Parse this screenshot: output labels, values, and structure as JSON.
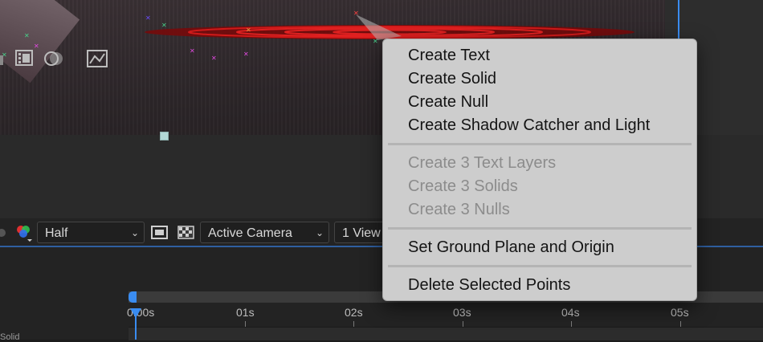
{
  "viewer": {
    "resolution": {
      "value": "Half"
    },
    "camera": {
      "value": "Active Camera"
    },
    "views": {
      "value": "1 View"
    }
  },
  "timeline": {
    "time_labels": [
      "0:00s",
      "01s",
      "02s",
      "03s",
      "04s",
      "05s"
    ],
    "layer_label": "Solid"
  },
  "context_menu": {
    "items": [
      {
        "label": "Create Text",
        "enabled": true
      },
      {
        "label": "Create Solid",
        "enabled": true
      },
      {
        "label": "Create Null",
        "enabled": true
      },
      {
        "label": "Create Shadow Catcher and Light",
        "enabled": true
      },
      {
        "label": "Create 3 Text Layers",
        "enabled": false
      },
      {
        "label": "Create 3 Solids",
        "enabled": false
      },
      {
        "label": "Create 3 Nulls",
        "enabled": false
      },
      {
        "label": "Set Ground Plane and Origin",
        "enabled": true
      },
      {
        "label": "Delete Selected Points",
        "enabled": true
      }
    ]
  },
  "colors": {
    "accent": "#3a8cf0",
    "menu_bg": "#cdcdcd",
    "target_red": "#c01818"
  },
  "icons": [
    "color-channel-icon",
    "chevron-down-icon",
    "region-of-interest-icon",
    "transparency-grid-icon",
    "composition-settings-icon",
    "motion-blur-icon",
    "graph-editor-icon"
  ]
}
